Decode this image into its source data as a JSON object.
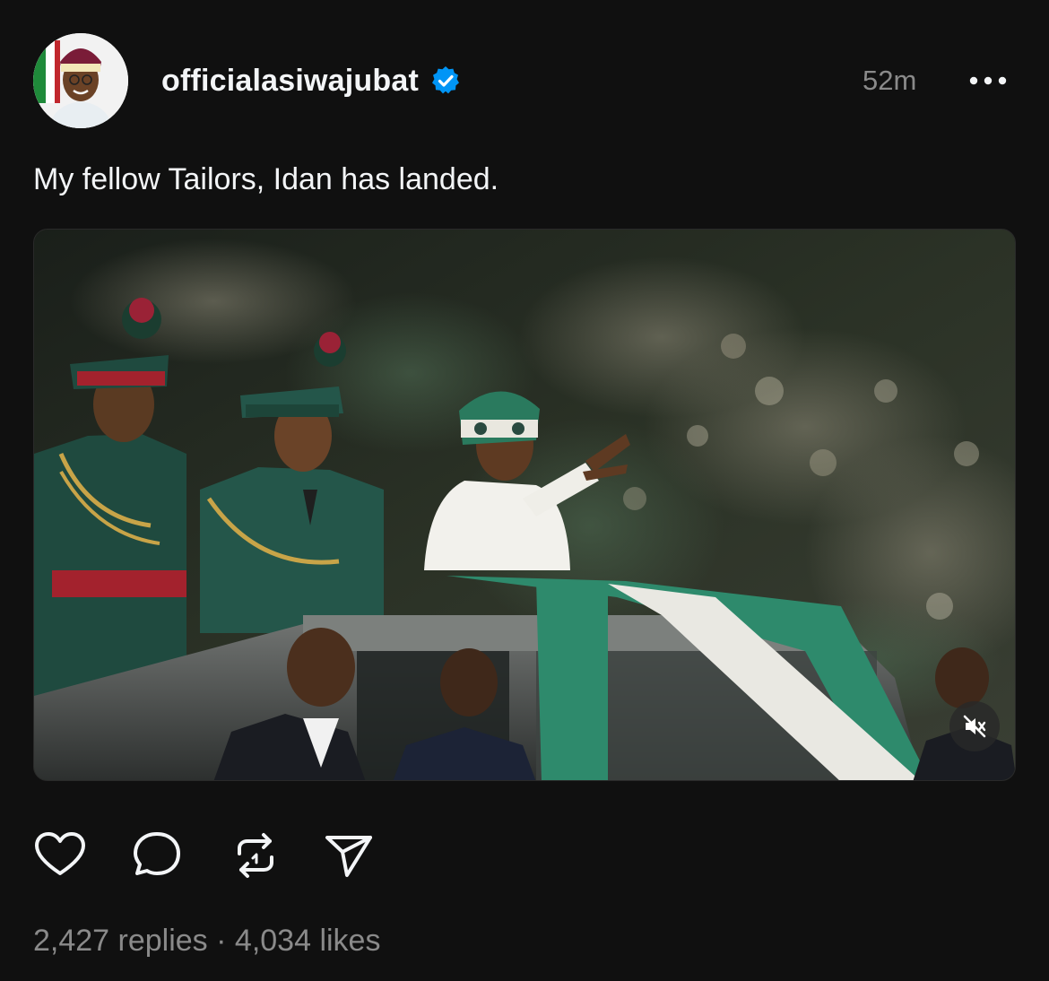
{
  "post": {
    "username": "officialasiwajubat",
    "verified": true,
    "timestamp": "52m",
    "caption": "My fellow Tailors, Idan has landed.",
    "media": {
      "type": "video",
      "muted": true
    },
    "stats": {
      "replies": "2,427 replies",
      "separator": "·",
      "likes": "4,034 likes"
    }
  },
  "icons": {
    "verified": "verified-badge-icon",
    "more": "more-horizontal-icon",
    "mute": "muted-speaker-icon",
    "like": "heart-icon",
    "reply": "comment-bubble-icon",
    "repost": "repost-icon",
    "share": "send-icon"
  },
  "colors": {
    "background": "#101010",
    "text_primary": "#f3f5f7",
    "text_secondary": "#8a8a8a",
    "verified_blue": "#0095f6"
  }
}
